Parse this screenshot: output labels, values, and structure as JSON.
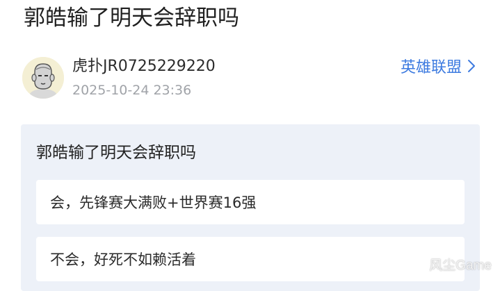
{
  "post": {
    "title": "郭皓输了明天会辞职吗",
    "author": {
      "name": "虎扑JR0725229220",
      "timestamp": "2025-10-24 23:36",
      "avatar_icon": "cartoon-head-avatar"
    },
    "topic": {
      "label": "英雄联盟",
      "icon": "chevron-right-icon",
      "color": "#3d7be0"
    }
  },
  "poll": {
    "question": "郭皓输了明天会辞职吗",
    "options": [
      {
        "label": "会，先锋赛大满败+世界赛16强"
      },
      {
        "label": "不会，好死不如赖活着"
      }
    ],
    "background_color": "#edf1f8"
  },
  "watermark": "风尘Game"
}
